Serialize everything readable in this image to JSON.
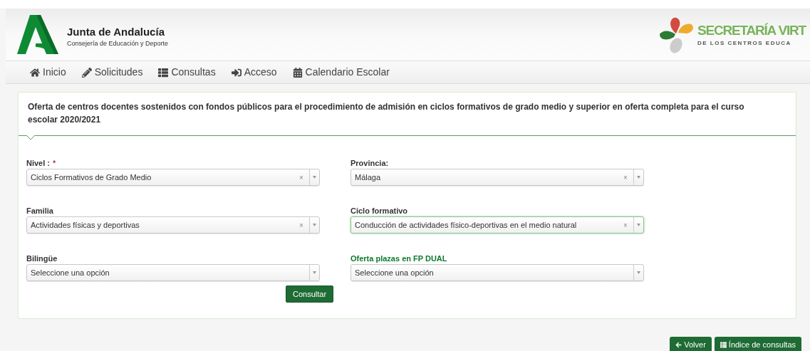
{
  "header": {
    "org_name": "Junta de Andalucía",
    "org_subtitle": "Consejería de Educación y Deporte",
    "app_name": "SECRETARÍA VIRT",
    "app_subtitle": "DE LOS CENTROS EDUCA"
  },
  "nav": [
    {
      "kind": "home",
      "label": "Inicio"
    },
    {
      "kind": "pencil",
      "label": "Solicitudes"
    },
    {
      "kind": "list",
      "label": "Consultas"
    },
    {
      "kind": "signin",
      "label": "Acceso"
    },
    {
      "kind": "calendar",
      "label": "Calendario Escolar"
    }
  ],
  "panel": {
    "title": "Oferta de centros docentes sostenidos con fondos públicos para el procedimiento de admisión en ciclos formativos de grado medio y superior en oferta completa para el curso escolar 2020/2021",
    "fields": [
      {
        "label": "Nivel :",
        "required_mark": "*",
        "accent": false,
        "focused": false,
        "value": "Ciclos Formativos de Grado Medio",
        "clear": "×"
      },
      {
        "label": "Provincia:",
        "accent": false,
        "focused": false,
        "value": "Málaga",
        "clear": "×"
      },
      {
        "label": "Familia",
        "accent": false,
        "focused": false,
        "value": "Actividades físicas y deportivas",
        "clear": "×"
      },
      {
        "label": "Ciclo formativo",
        "accent": false,
        "focused": true,
        "value": "Conducción de actividades físico-deportivas en el medio natural",
        "clear": "×"
      },
      {
        "label": "Bilingüe",
        "accent": false,
        "focused": false,
        "placeholder": "Seleccione una opción"
      },
      {
        "label": "Oferta plazas en FP DUAL",
        "accent": true,
        "focused": false,
        "placeholder": "Seleccione una opción"
      }
    ],
    "submit": "Consultar"
  },
  "footer_buttons": [
    {
      "kind": "back",
      "label": "Volver"
    },
    {
      "kind": "list",
      "label": "Índice de consultas"
    }
  ]
}
